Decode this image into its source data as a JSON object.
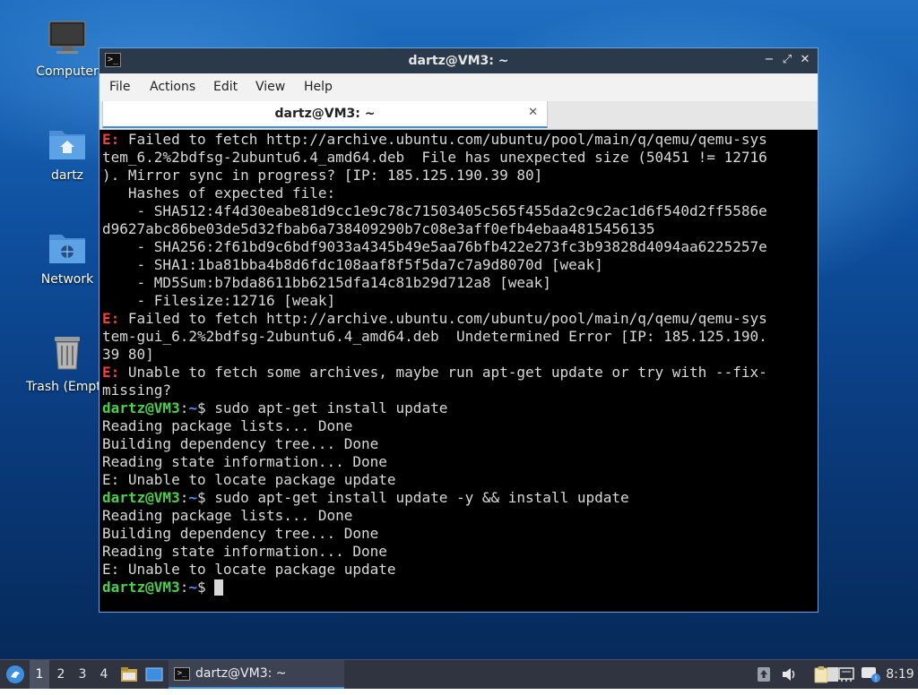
{
  "desktop": {
    "icons": [
      {
        "label": "Computer",
        "icon": "computer-icon"
      },
      {
        "label": "dartz",
        "icon": "home-folder-icon"
      },
      {
        "label": "Network",
        "icon": "network-folder-icon"
      },
      {
        "label": "Trash (Empty)",
        "icon": "trash-icon"
      }
    ]
  },
  "window": {
    "title": "dartz@VM3: ~",
    "menu": [
      "File",
      "Actions",
      "Edit",
      "View",
      "Help"
    ],
    "tab_label": "dartz@VM3: ~"
  },
  "terminal": {
    "lines": [
      [
        {
          "t": "E:",
          "c": "err"
        },
        {
          "t": " Failed to fetch http://archive.ubuntu.com/ubuntu/pool/main/q/qemu/qemu-sys"
        }
      ],
      [
        {
          "t": "tem_6.2%2bdfsg-2ubuntu6.4_amd64.deb  File has unexpected size (50451 != 12716"
        }
      ],
      [
        {
          "t": "). Mirror sync in progress? [IP: 185.125.190.39 80]"
        }
      ],
      [
        {
          "t": "   Hashes of expected file:"
        }
      ],
      [
        {
          "t": "    - SHA512:4f4d30eabe81d9cc1e9c78c71503405c565f455da2c9c2ac1d6f540d2ff5586e"
        }
      ],
      [
        {
          "t": "d9627abc86be03de5d32fbab6a738409290b7c08e3aff0efb4ebaa4815456135"
        }
      ],
      [
        {
          "t": "    - SHA256:2f61bd9c6bdf9033a4345b49e5aa76bfb422e273fc3b93828d4094aa6225257e"
        }
      ],
      [
        {
          "t": "    - SHA1:1ba81bba4b8d6fdc108aaf8f5f5da7c7a9d8070d [weak]"
        }
      ],
      [
        {
          "t": "    - MD5Sum:b7bda8611bb6215dfa14c81b29d712a8 [weak]"
        }
      ],
      [
        {
          "t": "    - Filesize:12716 [weak]"
        }
      ],
      [
        {
          "t": "E:",
          "c": "err"
        },
        {
          "t": " Failed to fetch http://archive.ubuntu.com/ubuntu/pool/main/q/qemu/qemu-sys"
        }
      ],
      [
        {
          "t": "tem-gui_6.2%2bdfsg-2ubuntu6.4_amd64.deb  Undetermined Error [IP: 185.125.190."
        }
      ],
      [
        {
          "t": "39 80]"
        }
      ],
      [
        {
          "t": "E:",
          "c": "err"
        },
        {
          "t": " Unable to fetch some archives, maybe run apt-get update or try with --fix-"
        }
      ],
      [
        {
          "t": "missing?"
        }
      ],
      [
        {
          "t": "dartz@VM3",
          "c": "user"
        },
        {
          "t": ":"
        },
        {
          "t": "~",
          "c": "path"
        },
        {
          "t": "$ sudo apt-get install update"
        }
      ],
      [
        {
          "t": "Reading package lists... Done"
        }
      ],
      [
        {
          "t": "Building dependency tree... Done"
        }
      ],
      [
        {
          "t": "Reading state information... Done"
        }
      ],
      [
        {
          "t": "E: Unable to locate package update"
        }
      ],
      [
        {
          "t": "dartz@VM3",
          "c": "user"
        },
        {
          "t": ":"
        },
        {
          "t": "~",
          "c": "path"
        },
        {
          "t": "$ sudo apt-get install update -y && install update"
        }
      ],
      [
        {
          "t": "Reading package lists... Done"
        }
      ],
      [
        {
          "t": "Building dependency tree... Done"
        }
      ],
      [
        {
          "t": "Reading state information... Done"
        }
      ],
      [
        {
          "t": "E: Unable to locate package update"
        }
      ],
      [
        {
          "t": "dartz@VM3",
          "c": "user"
        },
        {
          "t": ":"
        },
        {
          "t": "~",
          "c": "path"
        },
        {
          "t": "$ "
        }
      ]
    ]
  },
  "taskbar": {
    "workspaces": [
      "1",
      "2",
      "3",
      "4"
    ],
    "active_task": "dartz@VM3: ~",
    "clock": "8:19"
  },
  "colors": {
    "accent": "#3d8ee0",
    "error": "#ff3b30",
    "prompt_user": "#4ad04a",
    "prompt_path": "#5a8fff"
  }
}
